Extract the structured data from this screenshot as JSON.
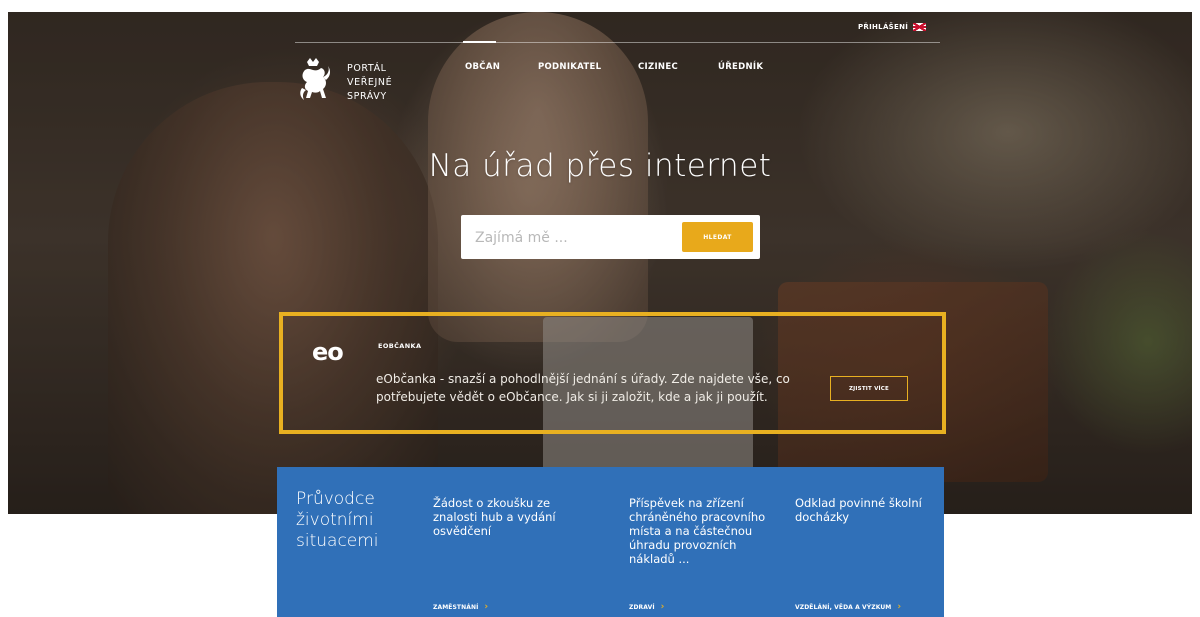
{
  "header": {
    "login_label": "PŘIHLÁŠENÍ",
    "language_flag_icon": "uk-flag-icon",
    "logo": {
      "emblem_icon": "czech-lion-emblem-icon",
      "line1": "PORTÁL",
      "line2": "VEŘEJNÉ",
      "line3": "SPRÁVY"
    },
    "nav": [
      {
        "label": "OBČAN",
        "active": true
      },
      {
        "label": "PODNIKATEL",
        "active": false
      },
      {
        "label": "CIZINEC",
        "active": false
      },
      {
        "label": "ÚŘEDNÍK",
        "active": false
      }
    ]
  },
  "hero": {
    "title": "Na úřad přes internet",
    "search": {
      "placeholder": "Zajímá mě ...",
      "button_label": "HLEDAT"
    }
  },
  "eobcanka": {
    "logo_text": "eo",
    "heading": "EOBČANKA",
    "text": "eObčanka - snazší a pohodlnější jednání s úřady. Zde najdete vše, co potřebujete vědět o eObčance. Jak si ji založit, kde a jak ji použít.",
    "button_label": "ZJISTIT VÍCE",
    "accent_color": "#e8b021"
  },
  "guide": {
    "title": "Průvodce životními situacemi",
    "color": "#3070b8",
    "items": [
      {
        "title": "Žádost o zkoušku ze znalosti hub a vydání osvědčení",
        "category": "ZAMĚSTNÁNÍ"
      },
      {
        "title": "Příspěvek na zřízení chráněného pracovního místa a na částečnou úhradu provozních nákladů ...",
        "category": "ZDRAVÍ"
      },
      {
        "title": "Odklad povinné školní docházky",
        "category": "VZDĚLÁNÍ, VĚDA A VÝZKUM"
      }
    ]
  }
}
